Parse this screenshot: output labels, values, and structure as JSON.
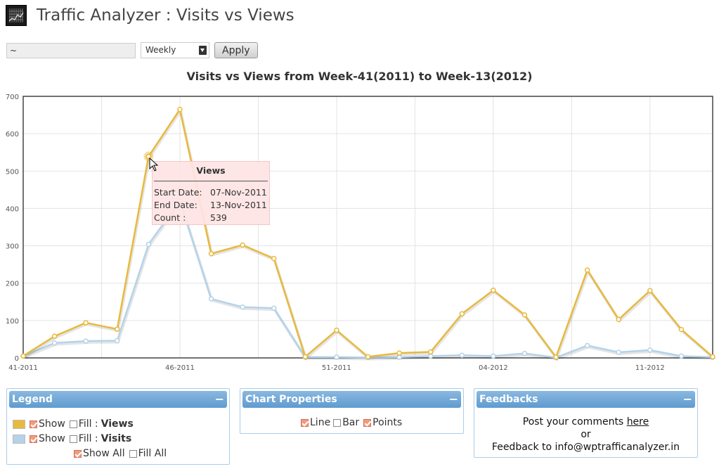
{
  "app": {
    "title": "Traffic Analyzer : Visits vs Views"
  },
  "controls": {
    "filter_value": "~",
    "period_value": "Weekly",
    "apply_label": "Apply"
  },
  "chart_title": "Visits vs Views from Week-41(2011) to Week-13(2012)",
  "chart_data": {
    "type": "line",
    "title": "Visits vs Views from Week-41(2011) to Week-13(2012)",
    "xlabel": "",
    "ylabel": "",
    "ylim": [
      0,
      700
    ],
    "y_ticks": [
      0,
      100,
      200,
      300,
      400,
      500,
      600,
      700
    ],
    "x_ticks": [
      "41-2011",
      "46-2011",
      "51-2011",
      "04-2012",
      "11-2012"
    ],
    "x_tick_index": [
      0,
      5,
      10,
      15,
      20
    ],
    "grid": true,
    "series": [
      {
        "name": "Views",
        "color": "#e8b93c",
        "values": [
          5,
          58,
          94,
          77,
          539,
          665,
          279,
          302,
          266,
          3,
          74,
          3,
          13,
          16,
          118,
          181,
          115,
          2,
          235,
          103,
          180,
          76,
          3
        ]
      },
      {
        "name": "Visits",
        "color": "#b4d3ea",
        "values": [
          5,
          40,
          45,
          46,
          304,
          420,
          158,
          136,
          133,
          2,
          2,
          1,
          2,
          5,
          7,
          5,
          12,
          1,
          33,
          15,
          21,
          5,
          2
        ]
      }
    ]
  },
  "tooltip": {
    "title": "Views",
    "start_label": "Start Date:",
    "start_value": "07-Nov-2011",
    "end_label": "End Date:",
    "end_value": "13-Nov-2011",
    "count_label": "Count :",
    "count_value": "539"
  },
  "legend_panel": {
    "title": "Legend",
    "show_label": "Show",
    "fill_label": "Fill :",
    "items": [
      {
        "name": "Views",
        "color": "#e8b93c",
        "show": true,
        "fill": false
      },
      {
        "name": "Visits",
        "color": "#b4d3ea",
        "show": true,
        "fill": false
      }
    ],
    "show_all_label": "Show All",
    "fill_all_label": "Fill All"
  },
  "chart_properties": {
    "title": "Chart Properties",
    "line_label": "Line",
    "bar_label": "Bar",
    "points_label": "Points"
  },
  "feedbacks": {
    "title": "Feedbacks",
    "line1_prefix": "Post your comments ",
    "line1_link": "here",
    "line2": "or",
    "line3": "Feedback to info@wptrafficanalyzer.in"
  }
}
